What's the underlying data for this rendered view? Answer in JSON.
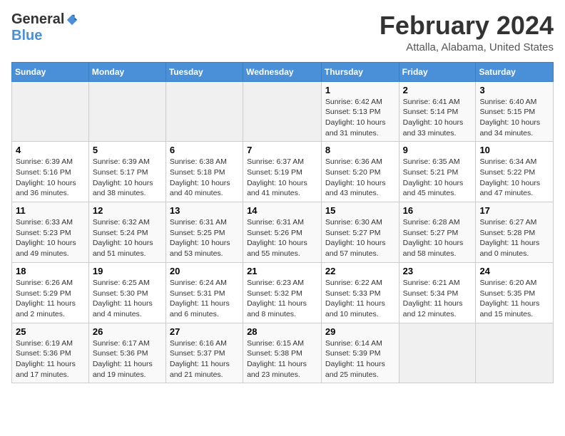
{
  "header": {
    "logo_general": "General",
    "logo_blue": "Blue",
    "month_year": "February 2024",
    "location": "Attalla, Alabama, United States"
  },
  "days_of_week": [
    "Sunday",
    "Monday",
    "Tuesday",
    "Wednesday",
    "Thursday",
    "Friday",
    "Saturday"
  ],
  "weeks": [
    [
      {
        "day": "",
        "info": ""
      },
      {
        "day": "",
        "info": ""
      },
      {
        "day": "",
        "info": ""
      },
      {
        "day": "",
        "info": ""
      },
      {
        "day": "1",
        "info": "Sunrise: 6:42 AM\nSunset: 5:13 PM\nDaylight: 10 hours\nand 31 minutes."
      },
      {
        "day": "2",
        "info": "Sunrise: 6:41 AM\nSunset: 5:14 PM\nDaylight: 10 hours\nand 33 minutes."
      },
      {
        "day": "3",
        "info": "Sunrise: 6:40 AM\nSunset: 5:15 PM\nDaylight: 10 hours\nand 34 minutes."
      }
    ],
    [
      {
        "day": "4",
        "info": "Sunrise: 6:39 AM\nSunset: 5:16 PM\nDaylight: 10 hours\nand 36 minutes."
      },
      {
        "day": "5",
        "info": "Sunrise: 6:39 AM\nSunset: 5:17 PM\nDaylight: 10 hours\nand 38 minutes."
      },
      {
        "day": "6",
        "info": "Sunrise: 6:38 AM\nSunset: 5:18 PM\nDaylight: 10 hours\nand 40 minutes."
      },
      {
        "day": "7",
        "info": "Sunrise: 6:37 AM\nSunset: 5:19 PM\nDaylight: 10 hours\nand 41 minutes."
      },
      {
        "day": "8",
        "info": "Sunrise: 6:36 AM\nSunset: 5:20 PM\nDaylight: 10 hours\nand 43 minutes."
      },
      {
        "day": "9",
        "info": "Sunrise: 6:35 AM\nSunset: 5:21 PM\nDaylight: 10 hours\nand 45 minutes."
      },
      {
        "day": "10",
        "info": "Sunrise: 6:34 AM\nSunset: 5:22 PM\nDaylight: 10 hours\nand 47 minutes."
      }
    ],
    [
      {
        "day": "11",
        "info": "Sunrise: 6:33 AM\nSunset: 5:23 PM\nDaylight: 10 hours\nand 49 minutes."
      },
      {
        "day": "12",
        "info": "Sunrise: 6:32 AM\nSunset: 5:24 PM\nDaylight: 10 hours\nand 51 minutes."
      },
      {
        "day": "13",
        "info": "Sunrise: 6:31 AM\nSunset: 5:25 PM\nDaylight: 10 hours\nand 53 minutes."
      },
      {
        "day": "14",
        "info": "Sunrise: 6:31 AM\nSunset: 5:26 PM\nDaylight: 10 hours\nand 55 minutes."
      },
      {
        "day": "15",
        "info": "Sunrise: 6:30 AM\nSunset: 5:27 PM\nDaylight: 10 hours\nand 57 minutes."
      },
      {
        "day": "16",
        "info": "Sunrise: 6:28 AM\nSunset: 5:27 PM\nDaylight: 10 hours\nand 58 minutes."
      },
      {
        "day": "17",
        "info": "Sunrise: 6:27 AM\nSunset: 5:28 PM\nDaylight: 11 hours\nand 0 minutes."
      }
    ],
    [
      {
        "day": "18",
        "info": "Sunrise: 6:26 AM\nSunset: 5:29 PM\nDaylight: 11 hours\nand 2 minutes."
      },
      {
        "day": "19",
        "info": "Sunrise: 6:25 AM\nSunset: 5:30 PM\nDaylight: 11 hours\nand 4 minutes."
      },
      {
        "day": "20",
        "info": "Sunrise: 6:24 AM\nSunset: 5:31 PM\nDaylight: 11 hours\nand 6 minutes."
      },
      {
        "day": "21",
        "info": "Sunrise: 6:23 AM\nSunset: 5:32 PM\nDaylight: 11 hours\nand 8 minutes."
      },
      {
        "day": "22",
        "info": "Sunrise: 6:22 AM\nSunset: 5:33 PM\nDaylight: 11 hours\nand 10 minutes."
      },
      {
        "day": "23",
        "info": "Sunrise: 6:21 AM\nSunset: 5:34 PM\nDaylight: 11 hours\nand 12 minutes."
      },
      {
        "day": "24",
        "info": "Sunrise: 6:20 AM\nSunset: 5:35 PM\nDaylight: 11 hours\nand 15 minutes."
      }
    ],
    [
      {
        "day": "25",
        "info": "Sunrise: 6:19 AM\nSunset: 5:36 PM\nDaylight: 11 hours\nand 17 minutes."
      },
      {
        "day": "26",
        "info": "Sunrise: 6:17 AM\nSunset: 5:36 PM\nDaylight: 11 hours\nand 19 minutes."
      },
      {
        "day": "27",
        "info": "Sunrise: 6:16 AM\nSunset: 5:37 PM\nDaylight: 11 hours\nand 21 minutes."
      },
      {
        "day": "28",
        "info": "Sunrise: 6:15 AM\nSunset: 5:38 PM\nDaylight: 11 hours\nand 23 minutes."
      },
      {
        "day": "29",
        "info": "Sunrise: 6:14 AM\nSunset: 5:39 PM\nDaylight: 11 hours\nand 25 minutes."
      },
      {
        "day": "",
        "info": ""
      },
      {
        "day": "",
        "info": ""
      }
    ]
  ]
}
